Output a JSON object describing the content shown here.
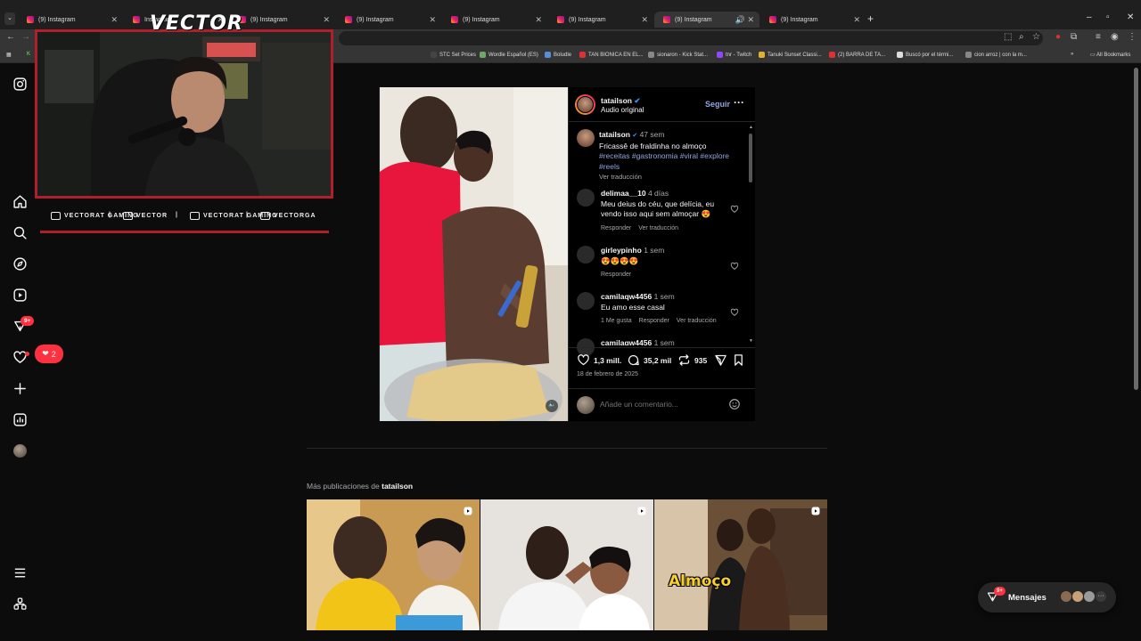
{
  "browser": {
    "tabs": [
      {
        "title": "(9) Instagram",
        "active": false
      },
      {
        "title": "Instagram",
        "active": false
      },
      {
        "title": "(9) Instagram",
        "active": false
      },
      {
        "title": "(9) Instagram",
        "active": false
      },
      {
        "title": "(9) Instagram",
        "active": false
      },
      {
        "title": "(9) Instagram",
        "active": false
      },
      {
        "title": "(9) Instagram",
        "active": true
      },
      {
        "title": "(9) Instagram",
        "active": false
      }
    ],
    "bookmarks": [
      {
        "label": "STC Set Prices",
        "color": "#444"
      },
      {
        "label": "Wordle Español (ES)",
        "color": "#6aaa64"
      },
      {
        "label": "Boludle",
        "color": "#5b8dd6"
      },
      {
        "label": "TAN BIONICA EN EL...",
        "color": "#e03030"
      },
      {
        "label": "sionaron - Kick Stat...",
        "color": "#888"
      },
      {
        "label": "tnr - Twitch",
        "color": "#9146ff"
      },
      {
        "label": "Tanuki Sunset Classi...",
        "color": "#e0b030"
      },
      {
        "label": "(2) BARRA DE TA...",
        "color": "#e03030"
      },
      {
        "label": "Buscó por el térmi...",
        "color": "#ddd"
      },
      {
        "label": "cion arroz | con la m...",
        "color": "#888"
      }
    ],
    "all_bookmarks": "All Bookmarks"
  },
  "overlay": {
    "logo": "VECTOR",
    "socials": [
      {
        "label": "VECTORAT GAMING",
        "icon": "youtube-icon"
      },
      {
        "label": "VECTOR",
        "icon": "twitch-icon"
      },
      {
        "label": "VECTORAT GAMING",
        "icon": "twitter-icon"
      },
      {
        "label": "VECTORGA",
        "icon": "instagram-icon"
      }
    ]
  },
  "sidebar": {
    "notifications_badge": "9+",
    "likes_count": "2"
  },
  "post": {
    "author": "tatailson",
    "audio": "Audio original",
    "follow": "Seguir",
    "caption": {
      "author": "tatailson",
      "time": "47 sem",
      "text": "Fricassê de fraldinha no almoço",
      "hashtags": "#receitas #gastronomia #viral #explore #reels",
      "translate": "Ver traducción"
    },
    "comments": [
      {
        "user": "delimaa__10",
        "time": "4 días",
        "text": "Meu deius do céu, que delícia, eu vendo isso aqui sem almoçar 😍",
        "actions": [
          "Responder",
          "Ver traducción"
        ]
      },
      {
        "user": "girleypinho",
        "time": "1 sem",
        "text": "😍😍😍😍",
        "actions": [
          "Responder"
        ]
      },
      {
        "user": "camilaqw4456",
        "time": "1 sem",
        "text": "Eu amo esse casal",
        "actions": [
          "1 Me gusta",
          "Responder",
          "Ver traducción"
        ]
      },
      {
        "user": "camilaqw4456",
        "time": "1 sem",
        "text": "",
        "actions": []
      }
    ],
    "likes": "1,3 mill.",
    "comments_count": "35,2 mil",
    "reposts": "935",
    "date": "18 de febrero de 2025",
    "comment_placeholder": "Añade un comentario..."
  },
  "more": {
    "prefix": "Más publicaciones de",
    "author": "tatailson",
    "thumb_text": "Almoço"
  },
  "messages": {
    "label": "Mensajes",
    "badge": "9+"
  }
}
